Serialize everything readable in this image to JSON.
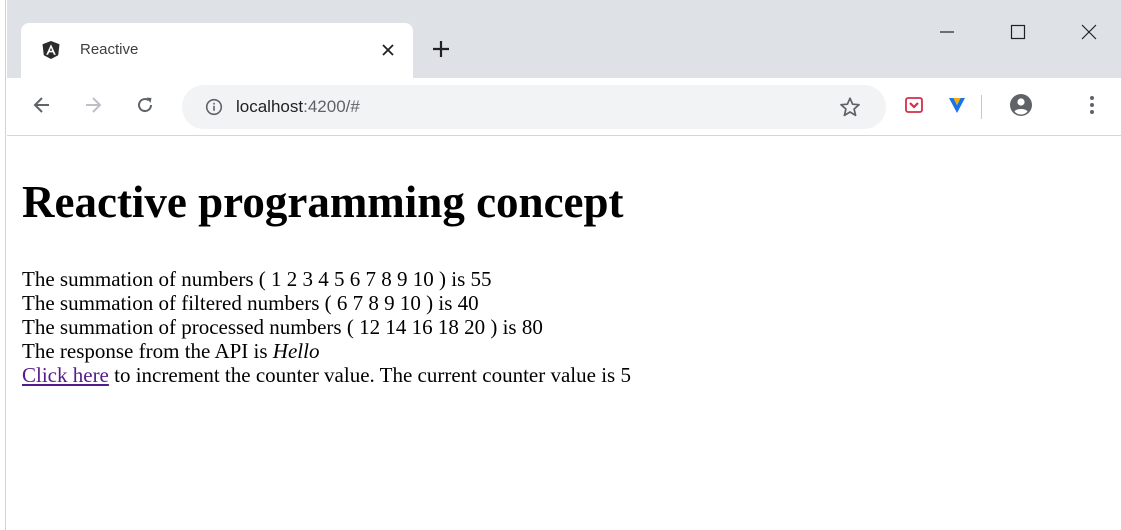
{
  "browser": {
    "tab": {
      "title": "Reactive",
      "favicon": "angular-logo-icon",
      "close_icon": "close-icon"
    },
    "new_tab_icon": "plus-icon",
    "window_controls": [
      "minimize-icon",
      "maximize-icon",
      "close-icon"
    ],
    "toolbar": {
      "back_icon": "arrow-left-icon",
      "forward_icon": "arrow-right-icon",
      "reload_icon": "reload-icon",
      "address": {
        "info_icon": "info-icon",
        "host": "localhost",
        "rest": ":4200/#"
      },
      "bookmark_icon": "star-icon",
      "extensions": [
        "pocket-icon",
        "extension-v-icon"
      ],
      "profile_icon": "account-circle-icon",
      "menu_icon": "more-vert-icon"
    },
    "colors": {
      "tabstrip": "#dee1e6",
      "omnibox": "#f1f3f4",
      "link": "#551a8b"
    }
  },
  "page": {
    "heading": "Reactive programming concept",
    "line1": "The summation of numbers ( 1 2 3 4 5 6 7 8 9 10 ) is 55",
    "line2": "The summation of filtered numbers ( 6 7 8 9 10 ) is 40",
    "line3": "The summation of processed numbers ( 12 14 16 18 20 ) is 80",
    "line4_prefix": "The response from the API is ",
    "line4_response": "Hello",
    "line5_link": "Click here",
    "line5_suffix": " to increment the counter value. The current counter value is 5"
  }
}
